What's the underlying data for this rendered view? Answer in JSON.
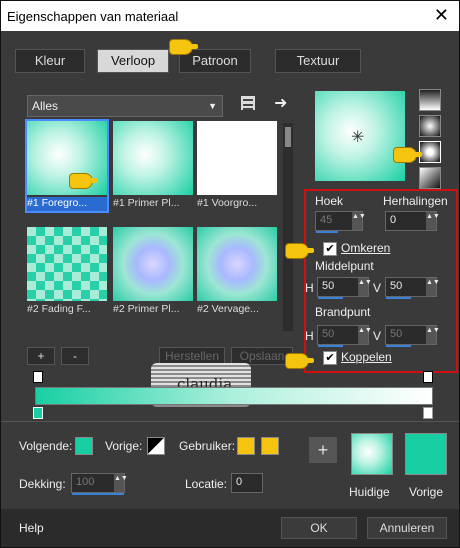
{
  "window": {
    "title": "Eigenschappen van materiaal",
    "close": "✕"
  },
  "tabs": [
    {
      "label": "Kleur"
    },
    {
      "label": "Verloop"
    },
    {
      "label": "Patroon"
    },
    {
      "label": "Textuur"
    }
  ],
  "category": {
    "selected": "Alles"
  },
  "gallery": [
    {
      "label": "#1 Foregro..."
    },
    {
      "label": "#1 Primer Pl..."
    },
    {
      "label": "#1 Voorgro..."
    },
    {
      "label": "#2 Fading F..."
    },
    {
      "label": "#2 Primer Pl..."
    },
    {
      "label": "#2 Vervage..."
    }
  ],
  "gallery_buttons": {
    "add": "+",
    "remove": "-",
    "restore": "Herstellen",
    "save": "Opslaan"
  },
  "props": {
    "angle_label": "Hoek",
    "angle_value": "45",
    "repeats_label": "Herhalingen",
    "repeats_value": "0",
    "invert_label": "Omkeren",
    "invert_checked": true,
    "center_label": "Middelpunt",
    "center_h": "50",
    "center_v": "50",
    "focal_label": "Brandpunt",
    "focal_h": "50",
    "focal_v": "50",
    "link_label": "Koppelen",
    "link_checked": true,
    "h_label": "H",
    "v_label": "V"
  },
  "watermark": {
    "text": "claudia"
  },
  "footer": {
    "next_label": "Volgende:",
    "prev_label": "Vorige:",
    "user_label": "Gebruiker:",
    "opacity_label": "Dekking:",
    "opacity_value": "100",
    "location_label": "Locatie:",
    "location_value": "0",
    "current_label": "Huidige",
    "previous_label": "Vorige",
    "plus": "+"
  },
  "bottom": {
    "help": "Help",
    "ok": "OK",
    "cancel": "Annuleren"
  },
  "colors": {
    "accent": "#18cfa3",
    "highlight": "#2a6bd0",
    "redbox": "#d01010",
    "user_color": "#f4c40e"
  }
}
